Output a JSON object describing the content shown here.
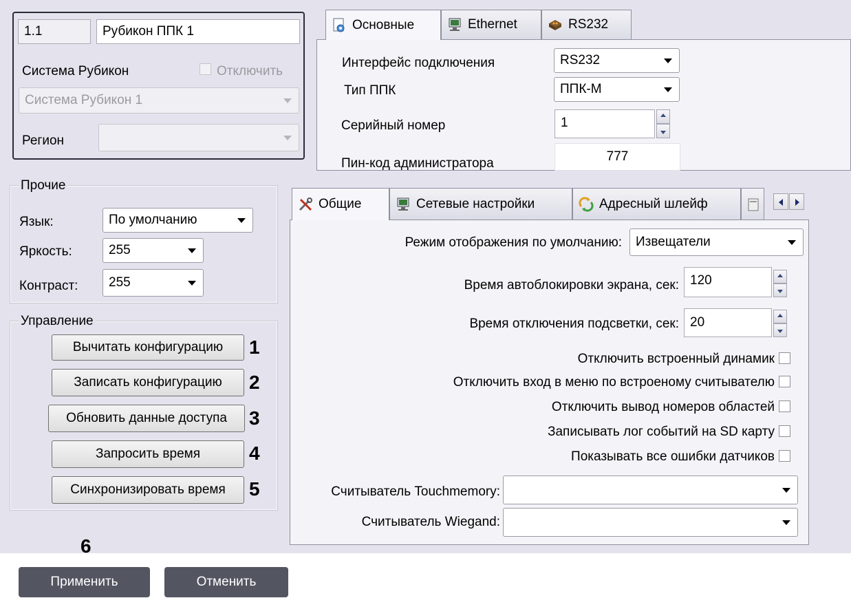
{
  "device": {
    "address": "1.1",
    "name": "Рубикон ППК 1",
    "system_label": "Система Рубикон",
    "disable_label": "Отключить",
    "system_value": "Система Рубикон 1",
    "region_label": "Регион",
    "region_value": ""
  },
  "top_tabs": [
    {
      "label": "Основные",
      "icon": "document-settings-icon"
    },
    {
      "label": "Ethernet",
      "icon": "network-monitor-icon"
    },
    {
      "label": "RS232",
      "icon": "serial-port-icon"
    }
  ],
  "basic": {
    "interface_label": "Интерфейс подключения",
    "interface_value": "RS232",
    "type_label": "Тип ППК",
    "type_value": "ППК-М",
    "serial_label": "Серийный номер",
    "serial_value": "1",
    "pin_label": "Пин-код администратора",
    "pin_value": "777"
  },
  "other": {
    "title": "Прочие",
    "language_label": "Язык:",
    "language_value": "По умолчанию",
    "brightness_label": "Яркость:",
    "brightness_value": "255",
    "contrast_label": "Контраст:",
    "contrast_value": "255"
  },
  "control": {
    "title": "Управление",
    "buttons": [
      {
        "label": "Вычитать конфигурацию",
        "number": "1"
      },
      {
        "label": "Записать конфигурацию",
        "number": "2"
      },
      {
        "label": "Обновить данные доступа",
        "number": "3"
      },
      {
        "label": "Запросить время",
        "number": "4"
      },
      {
        "label": "Синхронизировать время",
        "number": "5"
      }
    ]
  },
  "lower_tabs": [
    {
      "label": "Общие",
      "icon": "tools-icon"
    },
    {
      "label": "Сетевые настройки",
      "icon": "network-monitor-icon"
    },
    {
      "label": "Адресный шлейф",
      "icon": "address-loop-icon"
    }
  ],
  "general": {
    "display_mode_label": "Режим отображения по умолчанию:",
    "display_mode_value": "Извещатели",
    "autolock_label": "Время автоблокировки экрана, сек:",
    "autolock_value": "120",
    "backlight_label": "Время отключения подсветки, сек:",
    "backlight_value": "20",
    "checkboxes": [
      "Отключить встроенный динамик",
      "Отключить вход в меню по встроеному считывателю",
      "Отключить вывод номеров областей",
      "Записывать лог событий на SD карту",
      "Показывать все ошибки датчиков"
    ],
    "touchmemory_label": "Считыватель Touchmemory:",
    "touchmemory_value": "",
    "wiegand_label": "Считыватель Wiegand:",
    "wiegand_value": ""
  },
  "footer": {
    "apply_number": "6",
    "apply_label": "Применить",
    "cancel_label": "Отменить"
  }
}
